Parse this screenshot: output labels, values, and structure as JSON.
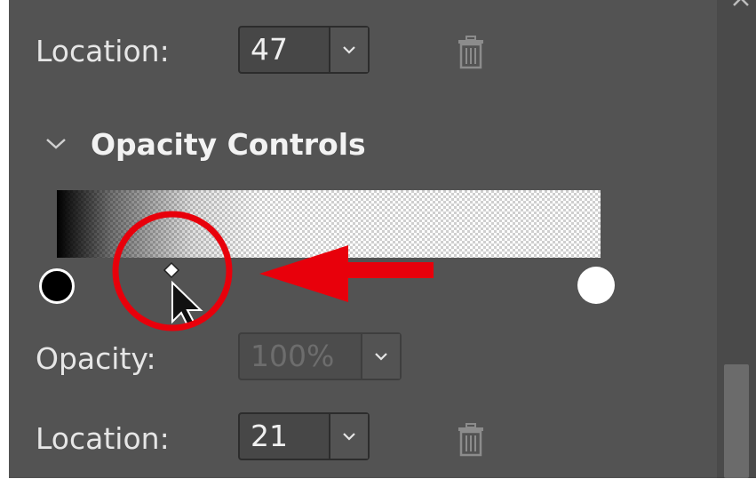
{
  "top_row": {
    "location_label": "Location:",
    "location_value": "47"
  },
  "opacity_section": {
    "title": "Opacity Controls",
    "opacity_label": "Opacity:",
    "opacity_value": "100%",
    "location_label": "Location:",
    "location_value": "21"
  },
  "icons": {
    "dropdown": "chevron-down-icon",
    "delete": "trash-icon",
    "collapse": "chevron-down-icon",
    "close": "close-icon"
  },
  "colors": {
    "panel_bg": "#535353",
    "annotation_red": "#e8000b",
    "text": "#e6e6e6"
  }
}
